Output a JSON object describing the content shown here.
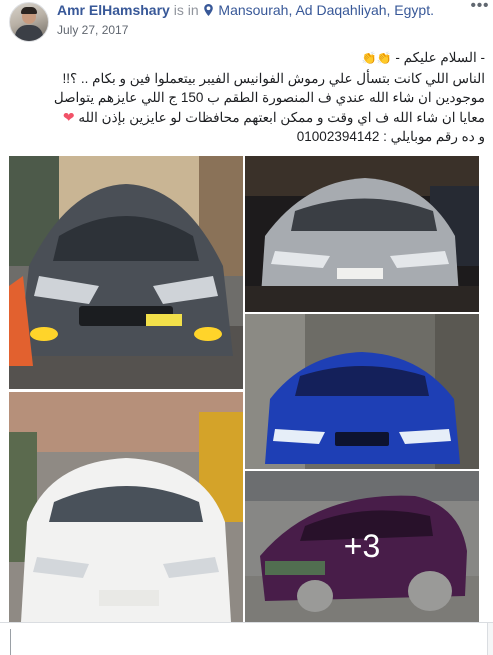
{
  "post": {
    "author": "Amr ElHamshary",
    "is_in_text": "is in",
    "location": "Mansourah, Ad Daqahliyah, Egypt.",
    "date": "July 27, 2017",
    "more_label": "•••",
    "lines": {
      "l1": "- السلام عليكم -",
      "l2": "الناس اللي كانت بتسأل علي رموش الفوانيس الفيبر بيتعملوا فين و بكام .. ؟!!",
      "l3": "موجودين ان شاء الله عندي ف المنصورة الطقم ب 150 ج اللي عايزهم يتواصل",
      "l4": "معايا ان شاء الله ف اي وقت و ممكن ابعتهم محافظات لو عايزين بإذن الله",
      "l5": "و ده رقم موبايلي : 01002394142"
    },
    "emoji": {
      "clap": "👏",
      "heart": "❤"
    },
    "more_photos_count": "+3"
  },
  "icons": {
    "place": "map-marker-icon",
    "more": "more-options-icon"
  },
  "colors": {
    "link": "#385898",
    "secondary_text": "#90949c",
    "date_text": "#616770",
    "heart": "#f25268"
  }
}
